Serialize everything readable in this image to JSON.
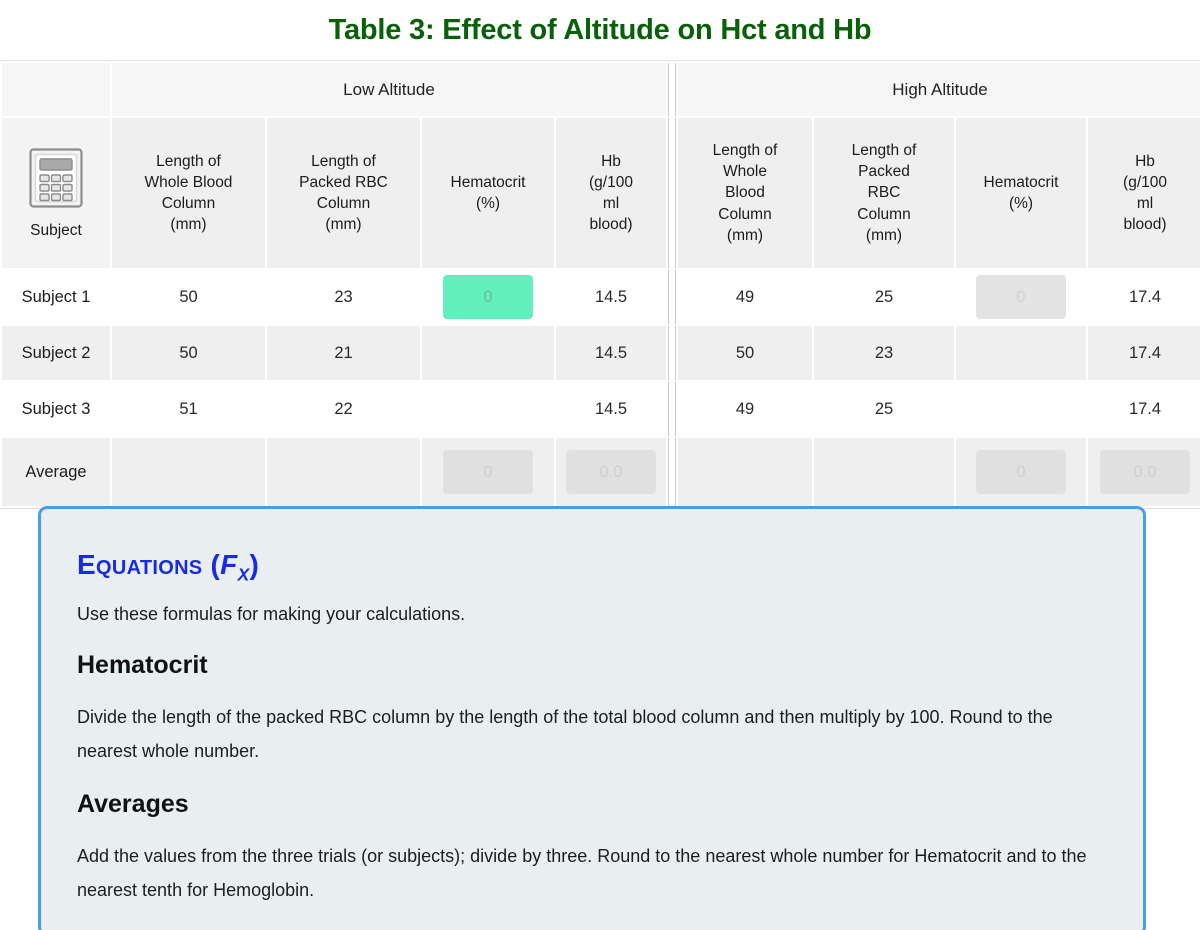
{
  "title": "Table 3: Effect of Altitude on Hct and Hb",
  "table": {
    "group_headers": {
      "blank": "",
      "low": "Low Altitude",
      "high": "High Altitude"
    },
    "subject_header": {
      "icon": "calculator-icon",
      "label": "Subject"
    },
    "columns": [
      "Length of Whole Blood Column (mm)",
      "Length of Packed RBC Column (mm)",
      "Hematocrit (%)",
      "Hb (g/100 ml blood)",
      "Length of Whole Blood Column (mm)",
      "Length of Packed RBC Column (mm)",
      "Hematocrit (%)",
      "Hb (g/100 ml blood)"
    ],
    "columns_lines": [
      [
        "Length of",
        "Whole Blood",
        "Column",
        "(mm)"
      ],
      [
        "Length of",
        "Packed RBC",
        "Column",
        "(mm)"
      ],
      [
        "Hematocrit",
        "(%)"
      ],
      [
        "Hb",
        "(g/100",
        "ml",
        "blood)"
      ],
      [
        "Length of",
        "Whole",
        "Blood",
        "Column",
        "(mm)"
      ],
      [
        "Length of",
        "Packed",
        "RBC",
        "Column",
        "(mm)"
      ],
      [
        "Hematocrit",
        "(%)"
      ],
      [
        "Hb",
        "(g/100",
        "ml",
        "blood)"
      ]
    ],
    "rows": [
      {
        "label": "Subject 1",
        "low_whole": "50",
        "low_packed": "23",
        "low_hct_value": "",
        "low_hct_placeholder": "0",
        "low_hb": "14.5",
        "high_whole": "49",
        "high_packed": "25",
        "high_hct_value": "",
        "high_hct_placeholder": "0",
        "high_hb": "17.4"
      },
      {
        "label": "Subject 2",
        "low_whole": "50",
        "low_packed": "21",
        "low_hct_value": "",
        "low_hct_placeholder": "",
        "low_hb": "14.5",
        "high_whole": "50",
        "high_packed": "23",
        "high_hct_value": "",
        "high_hct_placeholder": "",
        "high_hb": "17.4"
      },
      {
        "label": "Subject 3",
        "low_whole": "51",
        "low_packed": "22",
        "low_hct_value": "",
        "low_hct_placeholder": "",
        "low_hb": "14.5",
        "high_whole": "49",
        "high_packed": "25",
        "high_hct_value": "",
        "high_hct_placeholder": "",
        "high_hb": "17.4"
      }
    ],
    "average_row": {
      "label": "Average",
      "low_whole": "",
      "low_packed": "",
      "low_hct_placeholder": "0",
      "low_hb_placeholder": "0.0",
      "high_whole": "",
      "high_packed": "",
      "high_hct_placeholder": "0",
      "high_hb_placeholder": "0.0"
    }
  },
  "callout": {
    "title_main": "Equations",
    "title_fx_open": " (",
    "title_fx_f": "F",
    "title_fx_sub": "X",
    "title_fx_close": ")",
    "intro": "Use these formulas for making your calculations.",
    "sections": [
      {
        "heading": "Hematocrit",
        "body": "Divide the length of the packed RBC column by the length of the total blood column and then multiply by 100. Round to the nearest whole number."
      },
      {
        "heading": "Averages",
        "body": "Add the values from the three trials (or subjects); divide by three. Round to the nearest whole number for Hematocrit and to the nearest tenth for Hemoglobin."
      }
    ]
  },
  "colors": {
    "title_green": "#096009",
    "active_cell_green": "#62efbe",
    "callout_border_blue": "#4d9ce8",
    "callout_bg": "#e9eff1",
    "equations_blue": "#1a2ae0"
  }
}
